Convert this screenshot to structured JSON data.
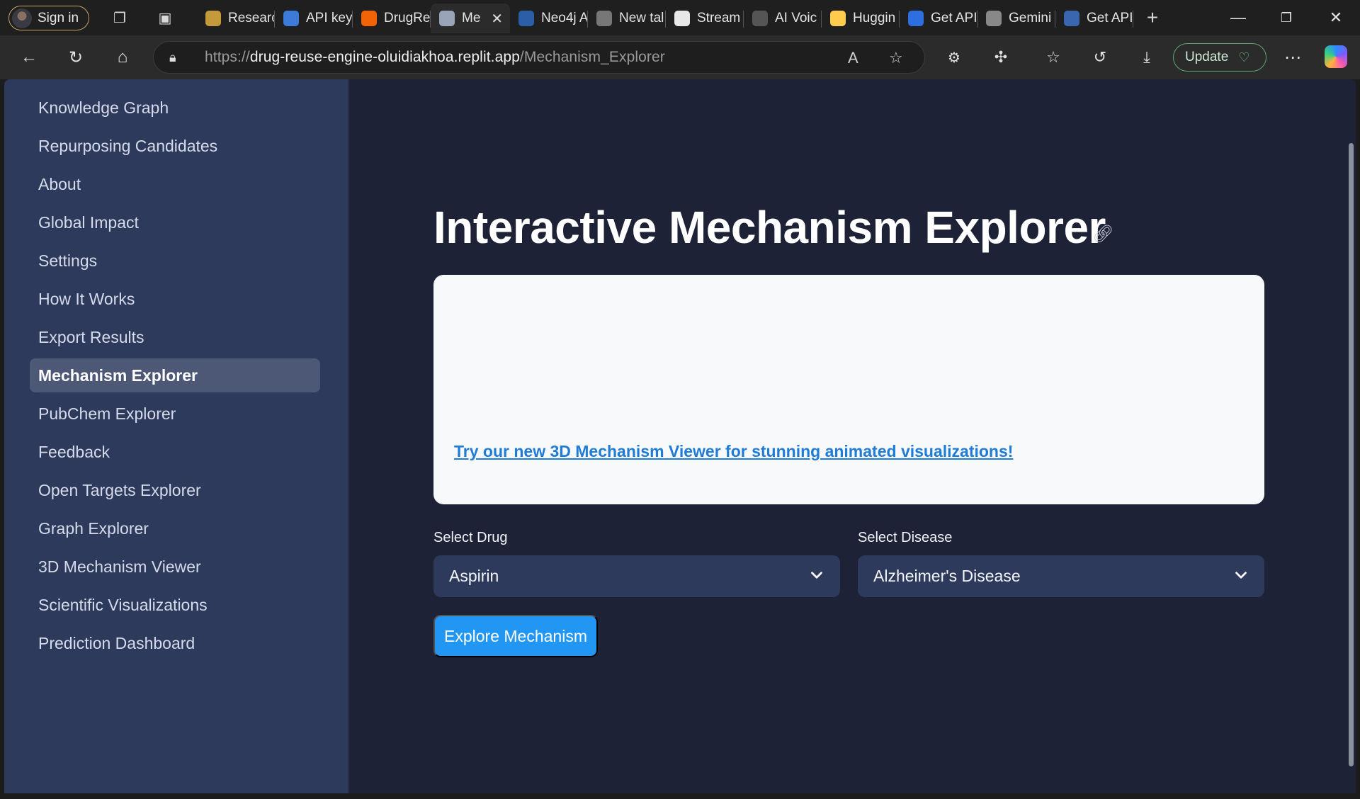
{
  "browser": {
    "profile": {
      "sign_in_label": "Sign in"
    },
    "tabs": [
      {
        "label": "Researc",
        "icon": "paw-icon",
        "color": "#c49a3a"
      },
      {
        "label": "API key",
        "icon": "openai-icon",
        "color": "#3d7bd9"
      },
      {
        "label": "DrugRe",
        "icon": "replit-icon",
        "color": "#f26207"
      },
      {
        "label": "Me",
        "icon": "microscope-icon",
        "color": "#9aa4b8",
        "active": true
      },
      {
        "label": "Neo4j A",
        "icon": "neo4j-icon",
        "color": "#2a5fa8"
      },
      {
        "label": "New tal",
        "icon": "newtab-icon",
        "color": "#777777"
      },
      {
        "label": "Stream",
        "icon": "openai-icon",
        "color": "#e8e8e8"
      },
      {
        "label": "AI Voic",
        "icon": "pause-icon",
        "color": "#555555"
      },
      {
        "label": "Huggin",
        "icon": "huggingface-icon",
        "color": "#ffcc4d"
      },
      {
        "label": "Get API",
        "icon": "bluesky-icon",
        "color": "#2d6fe0"
      },
      {
        "label": "Gemini",
        "icon": "google-icon",
        "color": "#888888"
      },
      {
        "label": "Get API",
        "icon": "bluesky-icon",
        "color": "#3a66b0"
      }
    ],
    "address": {
      "scheme": "https://",
      "host": "drug-reuse-engine-oluidiakhoa.replit.app",
      "path": "/Mechanism_Explorer"
    },
    "update_label": "Update"
  },
  "sidebar": {
    "items": [
      {
        "label": "Knowledge Graph"
      },
      {
        "label": "Repurposing Candidates"
      },
      {
        "label": "About"
      },
      {
        "label": "Global Impact"
      },
      {
        "label": "Settings"
      },
      {
        "label": "How It Works"
      },
      {
        "label": "Export Results"
      },
      {
        "label": "Mechanism Explorer",
        "active": true
      },
      {
        "label": "PubChem Explorer"
      },
      {
        "label": "Feedback"
      },
      {
        "label": "Open Targets Explorer"
      },
      {
        "label": "Graph Explorer"
      },
      {
        "label": "3D Mechanism Viewer"
      },
      {
        "label": "Scientific Visualizations"
      },
      {
        "label": "Prediction Dashboard"
      }
    ]
  },
  "main": {
    "title": "Interactive Mechanism Explorer",
    "promo_link": "Try our new 3D Mechanism Viewer for stunning animated visualizations!",
    "drug": {
      "label": "Select Drug",
      "value": "Aspirin"
    },
    "disease": {
      "label": "Select Disease",
      "value": "Alzheimer's Disease"
    },
    "explore_button": "Explore Mechanism"
  },
  "colors": {
    "sidebar_bg": "#2e3a5c",
    "main_bg": "#1d2236",
    "accent": "#2196f3",
    "link": "#1e7bd8"
  }
}
